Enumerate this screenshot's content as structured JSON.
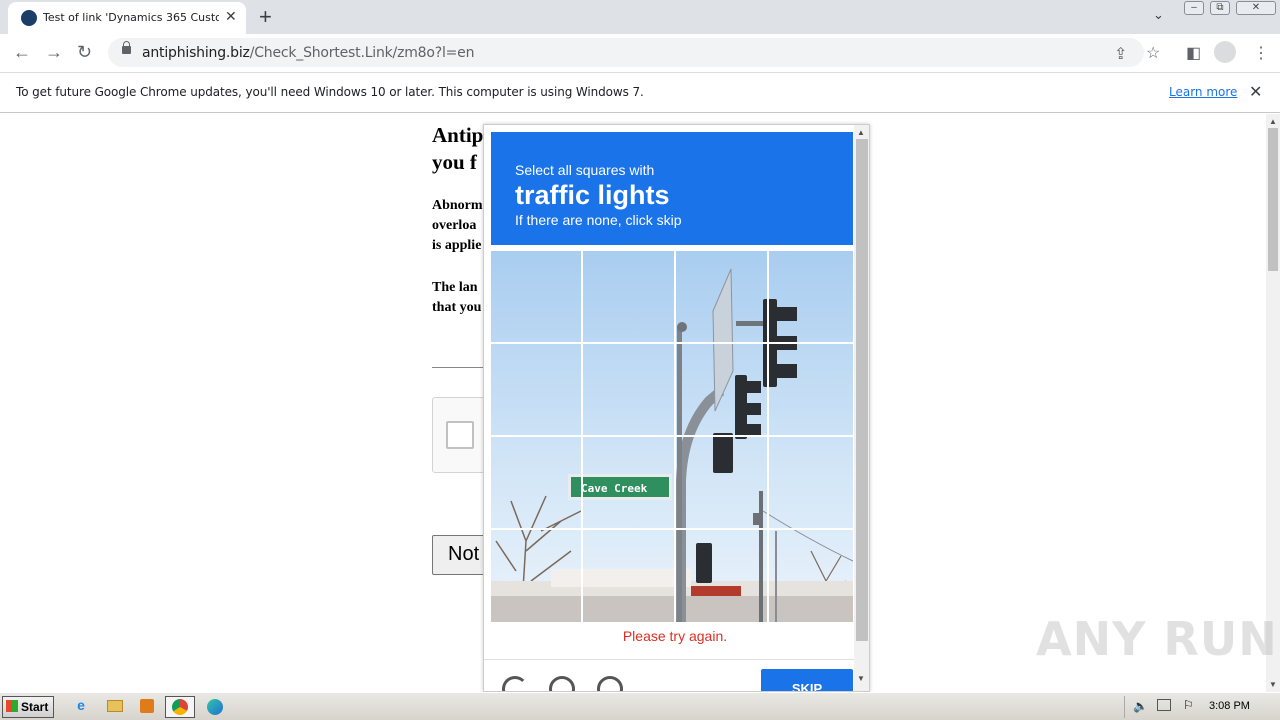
{
  "browser": {
    "tab_title": "Test of link 'Dynamics 365 Customer",
    "url_host": "antiphishing.biz",
    "url_path": "/Check_Shortest.Link/zm8o?l=en",
    "window_controls": [
      "minimize",
      "restore",
      "close"
    ]
  },
  "infobar": {
    "message": "To get future Google Chrome updates, you'll need Windows 10 or later. This computer is using Windows 7.",
    "link": "Learn more"
  },
  "page": {
    "title": "Antip you f",
    "para1": "Abnorm\noverloa\nis applie",
    "para2": "The lan\nthat you",
    "button": "Not"
  },
  "captcha": {
    "instruction_small": "Select all squares with",
    "target": "traffic lights",
    "instruction_sub": "If there are none, click skip",
    "error": "Please try again.",
    "skip_label": "SKIP",
    "sign_text": "Cave Creek",
    "grid_rows": 4,
    "grid_cols": 4,
    "colors": {
      "header": "#1a73e8",
      "error": "#d93025"
    }
  },
  "watermark": "ANY RUN",
  "taskbar": {
    "start": "Start",
    "clock": "3:08 PM",
    "apps": [
      "internet-explorer",
      "file-explorer",
      "media-player",
      "chrome",
      "edge"
    ]
  }
}
